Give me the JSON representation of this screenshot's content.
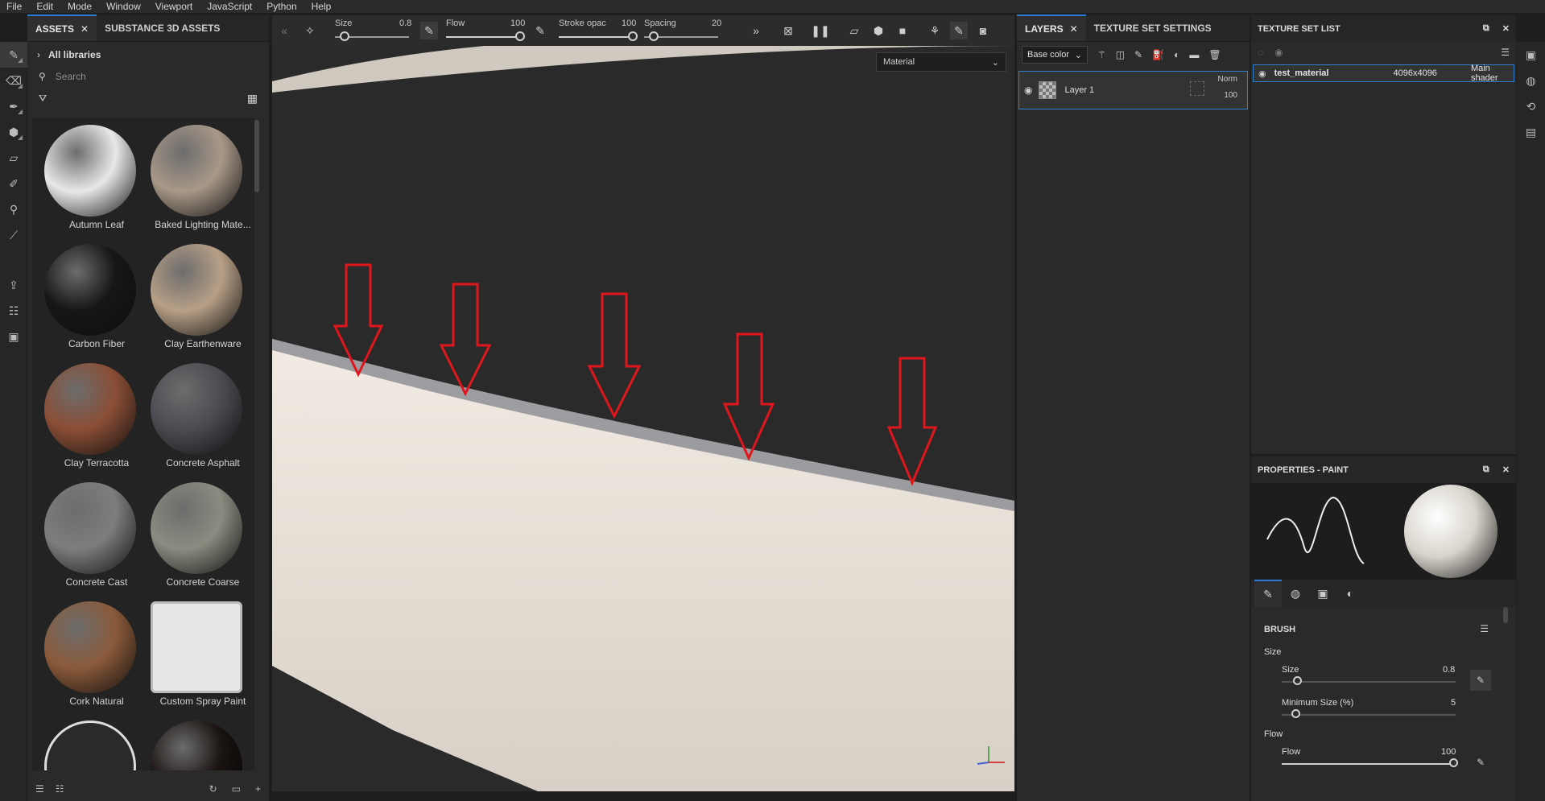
{
  "menu": [
    "File",
    "Edit",
    "Mode",
    "Window",
    "Viewport",
    "JavaScript",
    "Python",
    "Help"
  ],
  "assets": {
    "tabs": [
      {
        "label": "ASSETS",
        "closable": true,
        "active": true
      },
      {
        "label": "SUBSTANCE 3D ASSETS",
        "closable": false,
        "active": false
      }
    ],
    "library": "All libraries",
    "search_placeholder": "Search",
    "items": [
      {
        "label": "Autumn Leaf",
        "color": "#e8e8e8"
      },
      {
        "label": "Baked Lighting Mate...",
        "color": "#a89888"
      },
      {
        "label": "Carbon Fiber",
        "color": "#161616"
      },
      {
        "label": "Clay Earthenware",
        "color": "#b79f86"
      },
      {
        "label": "Clay Terracotta",
        "color": "#8a4e35"
      },
      {
        "label": "Concrete Asphalt",
        "color": "#4b4c52"
      },
      {
        "label": "Concrete Cast",
        "color": "#7d7d7d"
      },
      {
        "label": "Concrete Coarse",
        "color": "#8a8c80"
      },
      {
        "label": "Cork Natural",
        "color": "#8a5a3a"
      },
      {
        "label": "Custom Spray Paint",
        "color": "#d0d0d0"
      }
    ]
  },
  "toolbar": {
    "size_label": "Size",
    "size_value": "0.8",
    "flow_label": "Flow",
    "flow_value": "100",
    "stroke_label": "Stroke opac",
    "stroke_value": "100",
    "spacing_label": "Spacing",
    "spacing_value": "20"
  },
  "viewport": {
    "mode_select": "Material"
  },
  "layers": {
    "tabs": [
      {
        "label": "LAYERS",
        "closable": true
      },
      {
        "label": "TEXTURE SET SETTINGS",
        "closable": false
      }
    ],
    "channel": "Base color",
    "layer": {
      "name": "Layer 1",
      "blend": "Norm",
      "opacity": "100"
    }
  },
  "texture_set": {
    "title": "TEXTURE SET LIST",
    "row": {
      "name": "test_material",
      "size": "4096x4096",
      "shader": "Main shader"
    }
  },
  "properties": {
    "title": "PROPERTIES - PAINT",
    "section": "BRUSH",
    "group_size": "Size",
    "size_label": "Size",
    "size_value": "0.8",
    "min_size_label": "Minimum Size (%)",
    "min_size_value": "5",
    "group_flow": "Flow",
    "flow_label": "Flow",
    "flow_value": "100"
  }
}
